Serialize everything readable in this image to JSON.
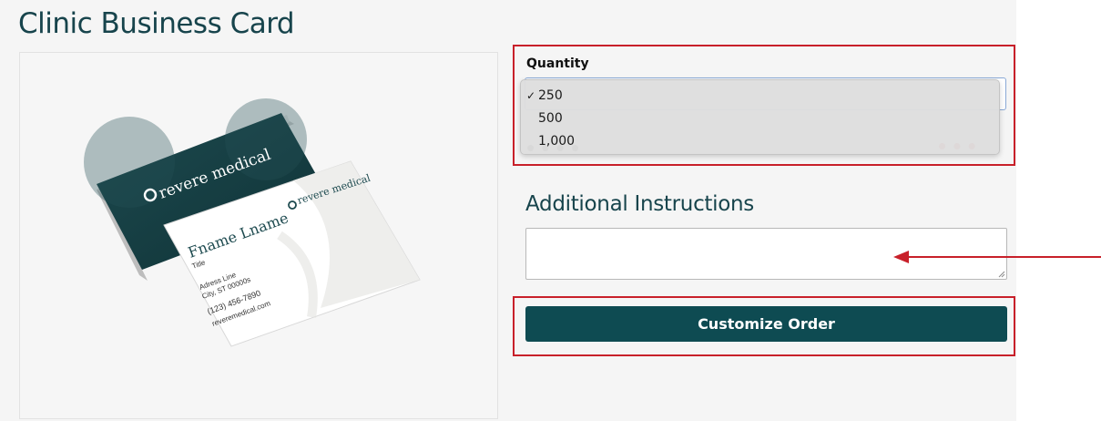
{
  "page": {
    "title": "Clinic Business Card"
  },
  "product_image": {
    "brand_name": "revere medical",
    "card_name": "Fname Lname",
    "card_title": "Title",
    "card_address_line": "Adress Line",
    "card_city": "City, ST 00000s",
    "card_phone": "(123) 456-7890",
    "card_website": "reveremedical.com"
  },
  "quantity": {
    "label": "Quantity",
    "options": [
      {
        "label": "250",
        "selected": true
      },
      {
        "label": "500",
        "selected": false
      },
      {
        "label": "1,000",
        "selected": false
      }
    ],
    "check_glyph": "✓"
  },
  "instructions": {
    "heading": "Additional Instructions",
    "value": ""
  },
  "actions": {
    "customize_label": "Customize Order"
  },
  "colors": {
    "brand": "#0e4b52",
    "highlight": "#c8202a",
    "title": "#17444c"
  },
  "icons": {
    "arrow": "arrow-left-icon",
    "logo": "revere-logo-icon",
    "grip": "resize-grip-icon"
  }
}
